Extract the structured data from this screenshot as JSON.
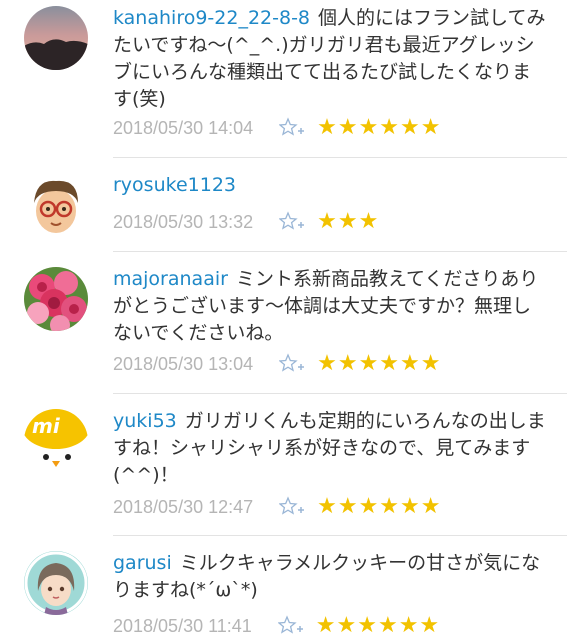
{
  "comments": [
    {
      "username": "kanahiro9-22_22-8-8",
      "text": "個人的にはフラン試してみたいですね〜(^_^.)ガリガリ君も最近アグレッシブにいろんな種類出てて出るたび試したくなります(笑)",
      "timestamp": "2018/05/30 14:04",
      "stars": "★★★★★★",
      "rating": 6,
      "avatar": "sunset-avatar"
    },
    {
      "username": "ryosuke1123",
      "text": "",
      "timestamp": "2018/05/30 13:32",
      "stars": "★★★",
      "rating": 3,
      "avatar": "glasses-avatar"
    },
    {
      "username": "majoranaair",
      "text": "ミント系新商品教えてくださりありがとうございます〜体調は大丈夫ですか？無理しないでくださいね。",
      "timestamp": "2018/05/30 13:04",
      "stars": "★★★★★★",
      "rating": 6,
      "avatar": "roses-avatar"
    },
    {
      "username": "yuki53",
      "text": "ガリガリくんも定期的にいろんなの出しますね！シャリシャリ系が好きなので、見てみます(^^)！",
      "timestamp": "2018/05/30 12:47",
      "stars": "★★★★★★",
      "rating": 6,
      "avatar": "chick-avatar"
    },
    {
      "username": "garusi",
      "text": "ミルクキャラメルクッキーの甘さが気になりますね(*´ω`*)",
      "timestamp": "2018/05/30 11:41",
      "stars": "★★★★★★",
      "rating": 6,
      "avatar": "anime-girl-avatar"
    }
  ],
  "colors": {
    "username": "#1e88c7",
    "timestamp": "#b5b5b5",
    "star": "#f2c200",
    "divider": "#e3e3e3"
  },
  "icons": {
    "fav": "star-plus-icon"
  }
}
